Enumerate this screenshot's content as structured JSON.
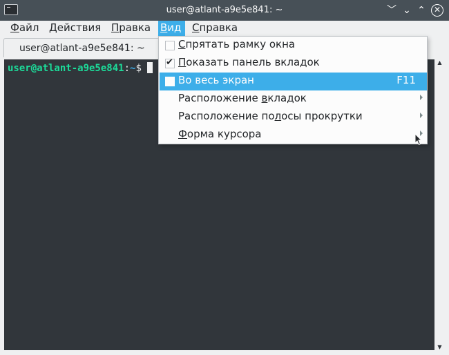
{
  "window": {
    "title": "user@atlant-a9e5e841: ~",
    "buttons": {
      "shade": "﹀",
      "minimize": "⌄",
      "maximize": "⌃",
      "close": "✕"
    }
  },
  "menubar": {
    "items": [
      {
        "label_u": "Ф",
        "label_rest": "айл"
      },
      {
        "label_u": "Д",
        "label_rest": "ействия"
      },
      {
        "label_u": "П",
        "label_rest": "равка"
      },
      {
        "label_u": "В",
        "label_rest": "ид"
      },
      {
        "label_u": "С",
        "label_rest": "правка"
      }
    ]
  },
  "tab": {
    "label": "user@atlant-a9e5e841: ~"
  },
  "terminal": {
    "user_host": "user@atlant-a9e5e841",
    "colon": ":",
    "path": "~",
    "symbol": "$ "
  },
  "view_menu": {
    "items": [
      {
        "label_u": "С",
        "label_rest": "прятать рамку окна",
        "checkbox": true,
        "checked": false
      },
      {
        "label_u": "П",
        "label_rest": "оказать панель вкладок",
        "checkbox": true,
        "checked": true
      },
      {
        "label": "Во весь экран",
        "checkbox": true,
        "checked": false,
        "shortcut": "F11",
        "highlighted": true
      },
      {
        "label_pre": "Расположение ",
        "label_u": "в",
        "label_rest": "кладок",
        "submenu": true
      },
      {
        "label_pre": "Расположение по",
        "label_u": "л",
        "label_rest": "осы прокрутки",
        "submenu": true
      },
      {
        "label_u": "Ф",
        "label_rest": "орма курсора",
        "submenu": true
      }
    ]
  },
  "colors": {
    "accent": "#3daee9",
    "terminal_bg": "#31363b",
    "titlebar": "#475057",
    "prompt_user": "#1cdc9a"
  }
}
